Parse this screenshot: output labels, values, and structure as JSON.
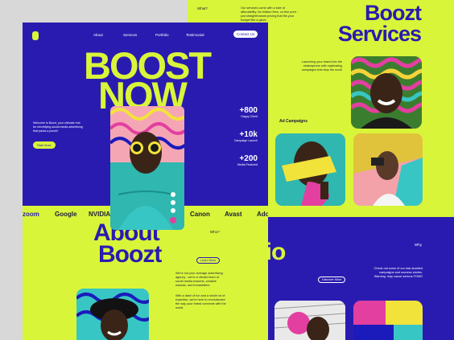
{
  "left_page": {
    "nav": [
      "About",
      "Services",
      "Portfolio",
      "Testimonial"
    ],
    "contact_label": "Contact Us",
    "hero_line1": "BOOST",
    "hero_line2": "NOW",
    "intro": "Welcome to Boozt, your ultimate hub for electrifying social media advertising that packs a punch!",
    "start_label": "Start Now",
    "stats": [
      {
        "value": "+800",
        "label": "Happy Client"
      },
      {
        "value": "+10k",
        "label": "Campaign Launch"
      },
      {
        "value": "+200",
        "label": "Media Featured"
      }
    ],
    "brands": [
      "zoom",
      "Google",
      "NVIDIA",
      "Canon",
      "Avast",
      "Ado"
    ],
    "about_line1": "About",
    "about_line2": "Boozt",
    "who_label": "Who?",
    "learn_label": "Learn More",
    "about_p1": "We're not your average advertising agency - we're a vibrant team of social media mavens, creative wizards, and trendsetters.",
    "about_p2": "With a dash of fun and a whole lot of expertise, we're here to revolutionize the way your brand connects with the world."
  },
  "right_page": {
    "what_label": "What?",
    "what_text": "Our services come with a side of affordability. No hidden fees, no fine print - just straightforward pricing that fits your budget like a glove.",
    "services_line1": "Boozt",
    "services_line2": "Services",
    "launch_text": "Launching your brand into the stratosphere with captivating campaigns that stop the scroll",
    "ad_campaigns": "Ad Campaigns",
    "why_label": "Why",
    "portfolio_fragment": "olio",
    "portfolio_text": "Check out some of our star-studded campaigns and success stories. Warning: may cause serious FOMO",
    "discover_label": "Discover More"
  },
  "colors": {
    "blue": "#2a1bb0",
    "lime": "#d9f53a",
    "white": "#ffffff"
  }
}
